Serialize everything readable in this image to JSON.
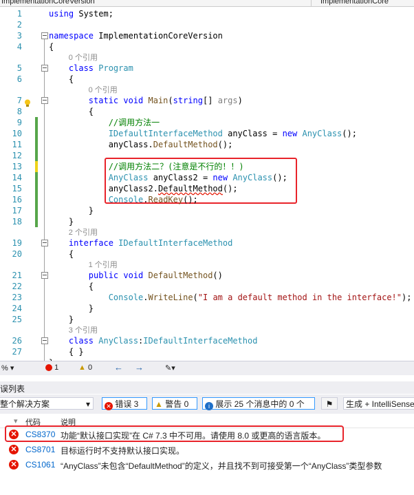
{
  "header": {
    "left_dropdown": "ImplementationCoreVersion",
    "right_dropdown": "ImplementationCore"
  },
  "editor": {
    "lines": [
      {
        "n": "1",
        "code": [
          {
            "t": "using ",
            "c": "kw"
          },
          {
            "t": "System;",
            "c": ""
          }
        ]
      },
      {
        "n": "2",
        "code": []
      },
      {
        "n": "3",
        "code": [
          {
            "t": "namespace ",
            "c": "kw"
          },
          {
            "t": "ImplementationCoreVersion",
            "c": ""
          }
        ]
      },
      {
        "n": "4",
        "code": [
          {
            "t": "{",
            "c": ""
          }
        ]
      },
      {
        "n": "5",
        "lens": "0 个引用",
        "code": [
          {
            "t": "    class ",
            "c": "kw"
          },
          {
            "t": "Program",
            "c": "ty"
          }
        ]
      },
      {
        "n": "6",
        "code": [
          {
            "t": "    {",
            "c": ""
          }
        ]
      },
      {
        "n": "7",
        "lens": "0 个引用",
        "code": [
          {
            "t": "        static void ",
            "c": "kw"
          },
          {
            "t": "Main",
            "c": "mt"
          },
          {
            "t": "(",
            "c": ""
          },
          {
            "t": "string",
            "c": "kw"
          },
          {
            "t": "[] ",
            "c": ""
          },
          {
            "t": "args",
            "c": "pm"
          },
          {
            "t": ")",
            "c": ""
          }
        ]
      },
      {
        "n": "8",
        "code": [
          {
            "t": "        {",
            "c": ""
          }
        ]
      },
      {
        "n": "9",
        "code": [
          {
            "t": "            //调用方法一",
            "c": "cm"
          }
        ]
      },
      {
        "n": "10",
        "code": [
          {
            "t": "            IDefaultInterfaceMethod ",
            "c": "ty"
          },
          {
            "t": "anyClass = ",
            "c": ""
          },
          {
            "t": "new ",
            "c": "kw"
          },
          {
            "t": "AnyClass",
            "c": "ty"
          },
          {
            "t": "();",
            "c": ""
          }
        ]
      },
      {
        "n": "11",
        "code": [
          {
            "t": "            anyClass.",
            "c": ""
          },
          {
            "t": "DefaultMethod",
            "c": "mt"
          },
          {
            "t": "();",
            "c": ""
          }
        ]
      },
      {
        "n": "12",
        "code": []
      },
      {
        "n": "13",
        "code": [
          {
            "t": "            //调用方法二？(注意是不行的！！)",
            "c": "cm"
          }
        ]
      },
      {
        "n": "14",
        "code": [
          {
            "t": "            AnyClass ",
            "c": "ty"
          },
          {
            "t": "anyClass2 = ",
            "c": ""
          },
          {
            "t": "new ",
            "c": "kw"
          },
          {
            "t": "AnyClass",
            "c": "ty"
          },
          {
            "t": "();",
            "c": ""
          }
        ]
      },
      {
        "n": "15",
        "code": [
          {
            "t": "            anyClass2.",
            "c": ""
          },
          {
            "t": "DefaultMethod",
            "c": "squig"
          },
          {
            "t": "();",
            "c": ""
          }
        ]
      },
      {
        "n": "16",
        "code": [
          {
            "t": "            Console",
            "c": "ty"
          },
          {
            "t": ".",
            "c": ""
          },
          {
            "t": "ReadKey",
            "c": "mt"
          },
          {
            "t": "();",
            "c": ""
          }
        ]
      },
      {
        "n": "17",
        "code": [
          {
            "t": "        }",
            "c": ""
          }
        ]
      },
      {
        "n": "18",
        "code": [
          {
            "t": "    }",
            "c": ""
          }
        ]
      },
      {
        "n": "19",
        "lens": "2 个引用",
        "code": [
          {
            "t": "    interface ",
            "c": "kw"
          },
          {
            "t": "IDefaultInterfaceMethod",
            "c": "ty"
          }
        ]
      },
      {
        "n": "20",
        "code": [
          {
            "t": "    {",
            "c": ""
          }
        ]
      },
      {
        "n": "21",
        "lens": "1 个引用",
        "code": [
          {
            "t": "        public void ",
            "c": "kw"
          },
          {
            "t": "DefaultMethod",
            "c": "mt"
          },
          {
            "t": "()",
            "c": ""
          }
        ]
      },
      {
        "n": "22",
        "code": [
          {
            "t": "        {",
            "c": ""
          }
        ]
      },
      {
        "n": "23",
        "code": [
          {
            "t": "            Console",
            "c": "ty"
          },
          {
            "t": ".",
            "c": ""
          },
          {
            "t": "WriteLine",
            "c": "mt"
          },
          {
            "t": "(",
            "c": ""
          },
          {
            "t": "\"I am a default method in the interface!\"",
            "c": "st"
          },
          {
            "t": ");",
            "c": ""
          }
        ]
      },
      {
        "n": "24",
        "code": [
          {
            "t": "        }",
            "c": ""
          }
        ]
      },
      {
        "n": "25",
        "code": [
          {
            "t": "    }",
            "c": ""
          }
        ]
      },
      {
        "n": "26",
        "lens": "3 个引用",
        "code": [
          {
            "t": "    class ",
            "c": "kw"
          },
          {
            "t": "AnyClass",
            "c": "ty"
          },
          {
            "t": ":",
            "c": ""
          },
          {
            "t": "IDefaultInterfaceMethod",
            "c": "ty"
          }
        ]
      },
      {
        "n": "27",
        "code": [
          {
            "t": "    { }",
            "c": ""
          }
        ]
      },
      {
        "n": "",
        "code": [
          {
            "t": "}",
            "c": ""
          }
        ]
      }
    ]
  },
  "status": {
    "zoom": "%",
    "errors": "1",
    "warnings": "0"
  },
  "error_list": {
    "title": "误列表",
    "scope": "整个解决方案",
    "errors_btn": "错误 3",
    "warnings_btn": "警告 0",
    "messages_btn": "展示 25 个消息中的 0 个",
    "build_filter": "生成 + IntelliSense",
    "col_code": "代码",
    "col_desc": "说明",
    "rows": [
      {
        "code": "CS8370",
        "desc": "功能“默认接口实现”在 C# 7.3 中不可用。请使用 8.0 或更高的语言版本。"
      },
      {
        "code": "CS8701",
        "desc": "目标运行时不支持默认接口实现。"
      },
      {
        "code": "CS1061",
        "desc": "“AnyClass”未包含“DefaultMethod”的定义，并且找不到可接受第一个“AnyClass”类型参数"
      }
    ]
  },
  "colors": {
    "change_saved": "#57a64a",
    "change_unsaved": "#efd31a",
    "highlight": "#e8232a",
    "error": "#e51400"
  }
}
